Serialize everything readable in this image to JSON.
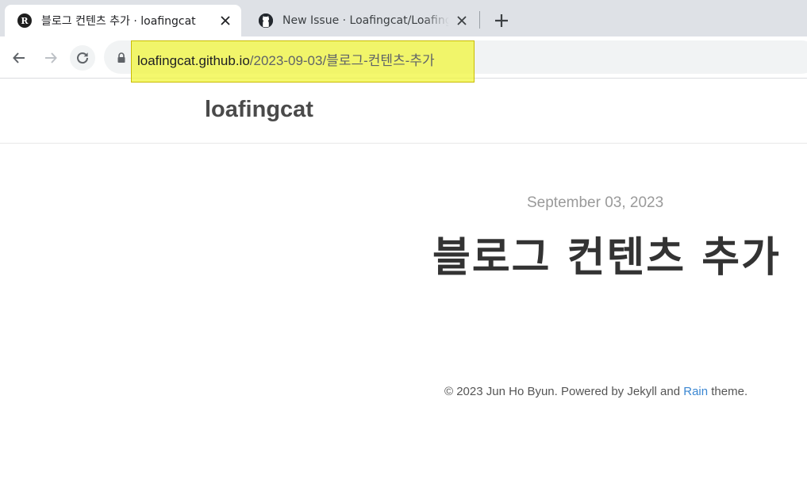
{
  "browser": {
    "tabs": [
      {
        "title": "블로그 컨텐츠 추가 · loafingcat",
        "favicon": "blog-favicon",
        "active": true
      },
      {
        "title": "New Issue · Loafingcat/Loafingcat",
        "favicon": "github-favicon",
        "active": false
      }
    ],
    "close_icon": "close-icon",
    "new_tab_icon": "plus-icon",
    "url_host": "loafingcat.github.io",
    "url_path": "/2023-09-03/블로그-컨텐츠-추가",
    "highlight_color": "#f5f55a"
  },
  "site": {
    "title": "loafingcat"
  },
  "post": {
    "date": "September 03, 2023",
    "title": "블로그 컨텐츠 추가"
  },
  "footer": {
    "prefix": "© 2023 Jun Ho Byun. Powered by Jekyll and ",
    "link": "Rain",
    "suffix": " theme.",
    "link_color": "#3b87d2"
  }
}
